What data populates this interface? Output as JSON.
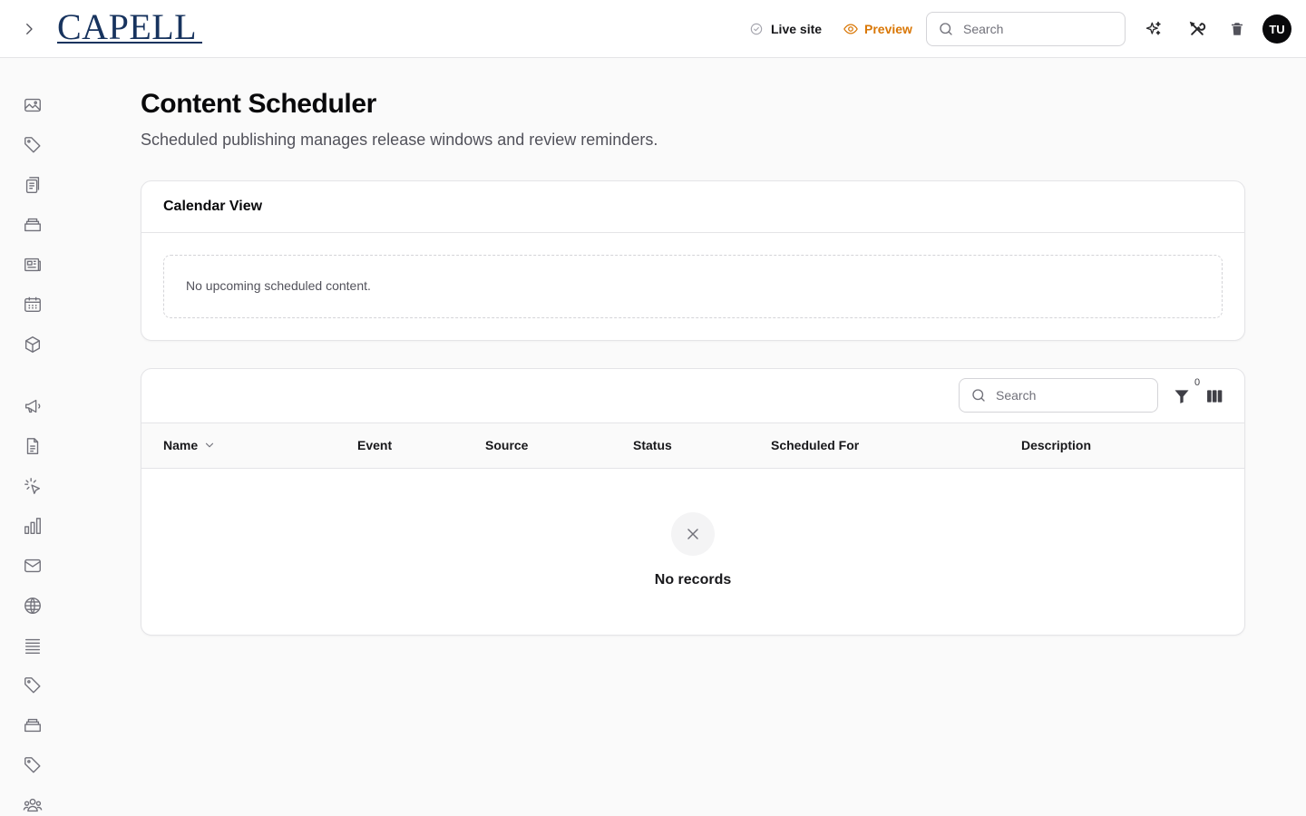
{
  "header": {
    "logo_text": "CAPELL",
    "live_site_label": "Live site",
    "preview_label": "Preview",
    "search_placeholder": "Search",
    "avatar_initials": "TU",
    "preview_color": "#d97706"
  },
  "sidebar": {
    "icons": [
      "image-icon",
      "tag-icon",
      "clipboard-icon",
      "inbox-icon",
      "newspaper-icon",
      "calendar-icon",
      "cube-icon",
      "megaphone-icon",
      "document-icon",
      "cursor-click-icon",
      "bar-chart-icon",
      "mail-icon",
      "globe-icon",
      "list-icon",
      "tag-icon",
      "inbox-icon",
      "tag-icon",
      "users-icon"
    ]
  },
  "page": {
    "title": "Content Scheduler",
    "subtitle": "Scheduled publishing manages release windows and review reminders."
  },
  "calendar": {
    "title": "Calendar View",
    "empty_message": "No upcoming scheduled content."
  },
  "table": {
    "search_placeholder": "Search",
    "filter_count": "0",
    "columns": [
      "Name",
      "Event",
      "Source",
      "Status",
      "Scheduled For",
      "Description"
    ],
    "rows": [],
    "empty_message": "No records"
  }
}
